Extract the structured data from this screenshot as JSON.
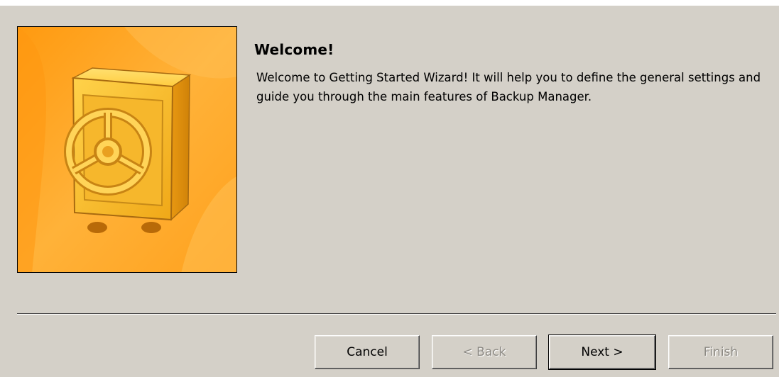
{
  "wizard": {
    "heading": "Welcome!",
    "body": "Welcome to Getting Started Wizard! It will help you to define the general settings and guide you through the main features of Backup Manager."
  },
  "image": {
    "icon": "safe-vault-icon",
    "background_color": "#ffa51e",
    "safe_color": "#f7b82a"
  },
  "buttons": {
    "cancel": {
      "label": "Cancel",
      "enabled": true
    },
    "back": {
      "label": "< Back",
      "enabled": false
    },
    "next": {
      "label": "Next >",
      "enabled": true
    },
    "finish": {
      "label": "Finish",
      "enabled": false
    }
  }
}
